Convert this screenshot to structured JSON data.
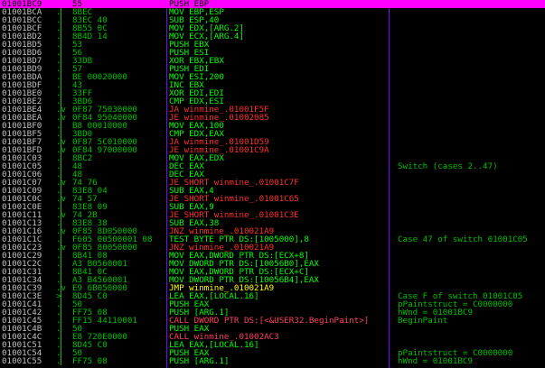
{
  "colors": {
    "background": "#000000",
    "selection": "#ff00ff",
    "text": "#00ff00",
    "jump": "#ff3030",
    "address": "#c0c0c0",
    "separator": "#8000ff"
  },
  "rows": [
    {
      "addr": "01001BC9",
      "bytes": "55",
      "instr": "PUSH EBP",
      "comment": "",
      "type": "normal",
      "arrow": ""
    },
    {
      "addr": "01001BCA",
      "bytes": "8BEC",
      "instr": "MOV EBP,ESP",
      "comment": "",
      "type": "normal",
      "arrow": "."
    },
    {
      "addr": "01001BCC",
      "bytes": "83EC 40",
      "instr": "SUB ESP,40",
      "comment": "",
      "type": "normal",
      "arrow": "."
    },
    {
      "addr": "01001BCF",
      "bytes": "8B55 0C",
      "instr": "MOV EDX,[ARG.2]",
      "comment": "",
      "type": "normal",
      "arrow": "."
    },
    {
      "addr": "01001BD2",
      "bytes": "8B4D 14",
      "instr": "MOV ECX,[ARG.4]",
      "comment": "",
      "type": "normal",
      "arrow": "."
    },
    {
      "addr": "01001BD5",
      "bytes": "53",
      "instr": "PUSH EBX",
      "comment": "",
      "type": "normal",
      "arrow": "."
    },
    {
      "addr": "01001BD6",
      "bytes": "56",
      "instr": "PUSH ESI",
      "comment": "",
      "type": "normal",
      "arrow": "."
    },
    {
      "addr": "01001BD7",
      "bytes": "33DB",
      "instr": "XOR EBX,EBX",
      "comment": "",
      "type": "normal",
      "arrow": "."
    },
    {
      "addr": "01001BD9",
      "bytes": "57",
      "instr": "PUSH EDI",
      "comment": "",
      "type": "normal",
      "arrow": "."
    },
    {
      "addr": "01001BDA",
      "bytes": "BE 00020000",
      "instr": "MOV ESI,200",
      "comment": "",
      "type": "normal",
      "arrow": "."
    },
    {
      "addr": "01001BDF",
      "bytes": "43",
      "instr": "INC EBX",
      "comment": "",
      "type": "normal",
      "arrow": "."
    },
    {
      "addr": "01001BE0",
      "bytes": "33FF",
      "instr": "XOR EDI,EDI",
      "comment": "",
      "type": "normal",
      "arrow": "."
    },
    {
      "addr": "01001BE2",
      "bytes": "3BD6",
      "instr": "CMP EDX,ESI",
      "comment": "",
      "type": "normal",
      "arrow": "."
    },
    {
      "addr": "01001BE4",
      "bytes": "0F87 75030000",
      "instr": "JA winmine_.01001F5F",
      "comment": "",
      "type": "jcc",
      "arrow": ".v"
    },
    {
      "addr": "01001BEA",
      "bytes": "0F84 95040000",
      "instr": "JE winmine_.01002085",
      "comment": "",
      "type": "jcc",
      "arrow": ".v"
    },
    {
      "addr": "01001BF0",
      "bytes": "B8 00010000",
      "instr": "MOV EAX,100",
      "comment": "",
      "type": "normal",
      "arrow": "."
    },
    {
      "addr": "01001BF5",
      "bytes": "3BD0",
      "instr": "CMP EDX,EAX",
      "comment": "",
      "type": "normal",
      "arrow": "."
    },
    {
      "addr": "01001BF7",
      "bytes": "0F87 5C010000",
      "instr": "JA winmine_.01001D59",
      "comment": "",
      "type": "jcc",
      "arrow": ".v"
    },
    {
      "addr": "01001BFD",
      "bytes": "0F84 97000000",
      "instr": "JE winmine_.01001C9A",
      "comment": "",
      "type": "jcc",
      "arrow": ".v"
    },
    {
      "addr": "01001C03",
      "bytes": "8BC2",
      "instr": "MOV EAX,EDX",
      "comment": "",
      "type": "normal",
      "arrow": "."
    },
    {
      "addr": "01001C05",
      "bytes": "48",
      "instr": "DEC EAX",
      "comment": "Switch (cases 2..47)",
      "type": "normal",
      "arrow": "."
    },
    {
      "addr": "01001C06",
      "bytes": "48",
      "instr": "DEC EAX",
      "comment": "",
      "type": "normal",
      "arrow": "."
    },
    {
      "addr": "01001C07",
      "bytes": "74 76",
      "instr": "JE SHORT winmine_.01001C7F",
      "comment": "",
      "type": "jcc",
      "arrow": ".v"
    },
    {
      "addr": "01001C09",
      "bytes": "83E8 04",
      "instr": "SUB EAX,4",
      "comment": "",
      "type": "normal",
      "arrow": "."
    },
    {
      "addr": "01001C0C",
      "bytes": "74 57",
      "instr": "JE SHORT winmine_.01001C65",
      "comment": "",
      "type": "jcc",
      "arrow": ".v"
    },
    {
      "addr": "01001C0E",
      "bytes": "83E8 09",
      "instr": "SUB EAX,9",
      "comment": "",
      "type": "normal",
      "arrow": "."
    },
    {
      "addr": "01001C11",
      "bytes": "74 2B",
      "instr": "JE SHORT winmine_.01001C3E",
      "comment": "",
      "type": "jcc",
      "arrow": ".v"
    },
    {
      "addr": "01001C13",
      "bytes": "83E8 38",
      "instr": "SUB EAX,38",
      "comment": "",
      "type": "normal",
      "arrow": "."
    },
    {
      "addr": "01001C16",
      "bytes": "0F85 8D050000",
      "instr": "JNZ winmine_.010021A9",
      "comment": "",
      "type": "jcc",
      "arrow": ".v"
    },
    {
      "addr": "01001C1C",
      "bytes": "F605 00500001 08",
      "instr": "TEST BYTE PTR DS:[1005000],8",
      "comment": "Case 47 of switch 01001C05",
      "type": "normal",
      "arrow": "."
    },
    {
      "addr": "01001C23",
      "bytes": "0F85 80050000",
      "instr": "JNZ winmine_.010021A9",
      "comment": "",
      "type": "jcc",
      "arrow": ".v"
    },
    {
      "addr": "01001C29",
      "bytes": "8B41 08",
      "instr": "MOV EAX,DWORD PTR DS:[ECX+8]",
      "comment": "",
      "type": "normal",
      "arrow": "."
    },
    {
      "addr": "01001C2C",
      "bytes": "A3 B0560001",
      "instr": "MOV DWORD PTR DS:[10056B0],EAX",
      "comment": "",
      "type": "normal",
      "arrow": "."
    },
    {
      "addr": "01001C31",
      "bytes": "8B41 0C",
      "instr": "MOV EAX,DWORD PTR DS:[ECX+C]",
      "comment": "",
      "type": "normal",
      "arrow": "."
    },
    {
      "addr": "01001C34",
      "bytes": "A3 B4560001",
      "instr": "MOV DWORD PTR DS:[10056B4],EAX",
      "comment": "",
      "type": "normal",
      "arrow": "."
    },
    {
      "addr": "01001C39",
      "bytes": "E9 6B050000",
      "instr": "JMP winmine_.010021A9",
      "comment": "",
      "type": "jmp",
      "arrow": ".v"
    },
    {
      "addr": "01001C3E",
      "bytes": "8D45 C0",
      "instr": "LEA EAX,[LOCAL.16]",
      "comment": "Case F of switch 01001C05",
      "type": "normal",
      "arrow": ">"
    },
    {
      "addr": "01001C41",
      "bytes": "50",
      "instr": "PUSH EAX",
      "comment": "pPaintstruct = C0000000",
      "type": "normal",
      "arrow": "."
    },
    {
      "addr": "01001C42",
      "bytes": "FF75 08",
      "instr": "PUSH [ARG.1]",
      "comment": "hWnd = 01001BC9",
      "type": "normal",
      "arrow": "."
    },
    {
      "addr": "01001C45",
      "bytes": "FF15 44110001",
      "instr": "CALL DWORD PTR DS:[<&USER32.BeginPaint>]",
      "comment": "BeginPaint",
      "type": "call",
      "arrow": "."
    },
    {
      "addr": "01001C4B",
      "bytes": "50",
      "instr": "PUSH EAX",
      "comment": "",
      "type": "normal",
      "arrow": "."
    },
    {
      "addr": "01001C4C",
      "bytes": "E8 720E0000",
      "instr": "CALL winmine_.01002AC3",
      "comment": "",
      "type": "call",
      "arrow": "."
    },
    {
      "addr": "01001C51",
      "bytes": "8D45 C0",
      "instr": "LEA EAX,[LOCAL.16]",
      "comment": "",
      "type": "normal",
      "arrow": "."
    },
    {
      "addr": "01001C54",
      "bytes": "50",
      "instr": "PUSH EAX",
      "comment": "pPaintstruct = C0000000",
      "type": "normal",
      "arrow": "."
    },
    {
      "addr": "01001C55",
      "bytes": "FF75 08",
      "instr": "PUSH [ARG.1]",
      "comment": "hWnd = 01001BC9",
      "type": "normal",
      "arrow": "."
    }
  ]
}
